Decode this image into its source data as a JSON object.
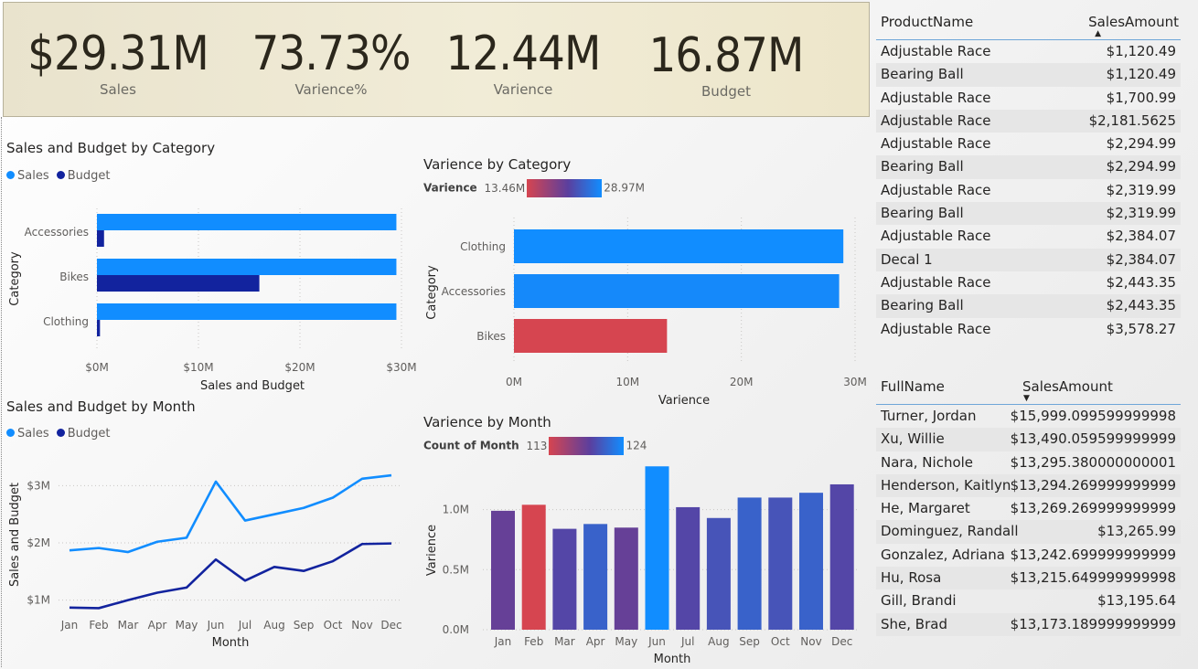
{
  "kpis": [
    {
      "value": "$29.31M",
      "label": "Sales"
    },
    {
      "value": "73.73%",
      "label": "Varience%"
    },
    {
      "value": "12.44M",
      "label": "Varience"
    },
    {
      "value": "16.87M",
      "label": "Budget"
    }
  ],
  "colors": {
    "sales": "#118dff",
    "budget": "#12239e",
    "low": "#d64550",
    "mid": "#5b3f9e",
    "high": "#118dff"
  },
  "legends": {
    "sales": "Sales",
    "budget": "Budget"
  },
  "chart_data": [
    {
      "type": "bar",
      "title": "Sales and Budget by Category",
      "xlabel": "Sales and Budget",
      "ylabel": "Category",
      "categories": [
        "Accessories",
        "Bikes",
        "Clothing"
      ],
      "series": [
        {
          "name": "Sales",
          "values": [
            29.5,
            29.5,
            29.5
          ]
        },
        {
          "name": "Budget",
          "values": [
            0.7,
            16.0,
            0.3
          ]
        }
      ],
      "xlim": [
        0,
        30
      ],
      "xticks": [
        "$0M",
        "$10M",
        "$20M",
        "$30M"
      ]
    },
    {
      "type": "bar",
      "title": "Varience by Category",
      "xlabel": "Varience",
      "ylabel": "Category",
      "categories": [
        "Clothing",
        "Accessories",
        "Bikes"
      ],
      "values": [
        28.97,
        28.6,
        13.46
      ],
      "xlim": [
        0,
        30
      ],
      "xticks": [
        "0M",
        "10M",
        "20M",
        "30M"
      ],
      "color_legend": {
        "label": "Varience",
        "min": "13.46M",
        "max": "28.97M"
      }
    },
    {
      "type": "line",
      "title": "Sales and Budget by Month",
      "xlabel": "Month",
      "ylabel": "Sales and Budget",
      "categories": [
        "Jan",
        "Feb",
        "Mar",
        "Apr",
        "May",
        "Jun",
        "Jul",
        "Aug",
        "Sep",
        "Oct",
        "Nov",
        "Dec"
      ],
      "series": [
        {
          "name": "Sales",
          "values": [
            1.87,
            1.91,
            1.84,
            2.02,
            2.09,
            3.07,
            2.39,
            2.5,
            2.61,
            2.79,
            3.12,
            3.18
          ]
        },
        {
          "name": "Budget",
          "values": [
            0.87,
            0.86,
            1.0,
            1.13,
            1.22,
            1.71,
            1.34,
            1.58,
            1.51,
            1.68,
            1.98,
            1.99
          ]
        }
      ],
      "ylim": [
        0.5,
        3.5
      ],
      "yticks": [
        "$1M",
        "$2M",
        "$3M"
      ]
    },
    {
      "type": "bar",
      "title": "Varience by Month",
      "xlabel": "Month",
      "ylabel": "Varience",
      "categories": [
        "Jan",
        "Feb",
        "Mar",
        "Apr",
        "May",
        "Jun",
        "Jul",
        "Aug",
        "Sep",
        "Oct",
        "Nov",
        "Dec"
      ],
      "values": [
        0.99,
        1.04,
        0.84,
        0.88,
        0.85,
        1.36,
        1.02,
        0.93,
        1.1,
        1.1,
        1.14,
        1.21
      ],
      "color_values": [
        118,
        113,
        119,
        121,
        118,
        124,
        119,
        120,
        121,
        120,
        121,
        119
      ],
      "ylim": [
        0,
        1.4
      ],
      "yticks": [
        "0.0M",
        "0.5M",
        "1.0M"
      ],
      "color_legend": {
        "label": "Count of Month",
        "min": "113",
        "max": "124"
      }
    }
  ],
  "product_table": {
    "headers": [
      "ProductName",
      "SalesAmount"
    ],
    "rows": [
      [
        "Adjustable Race",
        "$1,120.49"
      ],
      [
        "Bearing Ball",
        "$1,120.49"
      ],
      [
        "Adjustable Race",
        "$1,700.99"
      ],
      [
        "Adjustable Race",
        "$2,181.5625"
      ],
      [
        "Adjustable Race",
        "$2,294.99"
      ],
      [
        "Bearing Ball",
        "$2,294.99"
      ],
      [
        "Adjustable Race",
        "$2,319.99"
      ],
      [
        "Bearing Ball",
        "$2,319.99"
      ],
      [
        "Adjustable Race",
        "$2,384.07"
      ],
      [
        "Decal 1",
        "$2,384.07"
      ],
      [
        "Adjustable Race",
        "$2,443.35"
      ],
      [
        "Bearing Ball",
        "$2,443.35"
      ],
      [
        "Adjustable Race",
        "$3,578.27"
      ]
    ]
  },
  "customer_table": {
    "headers": [
      "FullName",
      "SalesAmount"
    ],
    "rows": [
      [
        "Turner, Jordan",
        "$15,999.099599999998"
      ],
      [
        "Xu, Willie",
        "$13,490.059599999999"
      ],
      [
        "Nara, Nichole",
        "$13,295.380000000001"
      ],
      [
        "Henderson, Kaitlyn",
        "$13,294.269999999999"
      ],
      [
        "He, Margaret",
        "$13,269.269999999999"
      ],
      [
        "Dominguez, Randall",
        "$13,265.99"
      ],
      [
        "Gonzalez, Adriana",
        "$13,242.699999999999"
      ],
      [
        "Hu, Rosa",
        "$13,215.649999999998"
      ],
      [
        "Gill, Brandi",
        "$13,195.64"
      ],
      [
        "She, Brad",
        "$13,173.189999999999"
      ]
    ]
  }
}
